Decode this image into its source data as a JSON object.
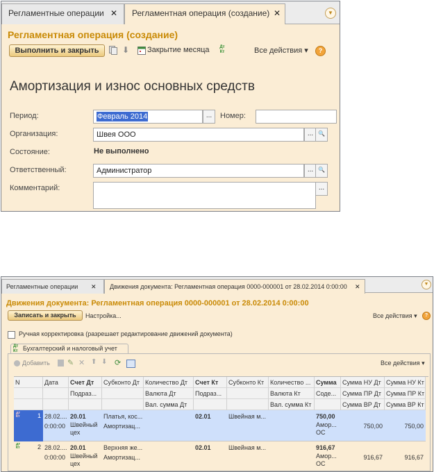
{
  "window1": {
    "tabs": [
      {
        "label": "Регламентные операции"
      },
      {
        "label": "Регламентная операция (создание)"
      }
    ],
    "close_glyph": "✕",
    "form_title": "Регламентная операция (создание)",
    "toolbar": {
      "run_close": "Выполнить и закрыть",
      "month_close": "Закрытие месяца",
      "all_actions": "Все действия ▾",
      "help": "?",
      "dtkt_icon_text": "Дт Кт"
    },
    "operation_title": "Амортизация и износ основных средств",
    "fields": {
      "period_label": "Период:",
      "period_value": "Февраль 2014",
      "number_label": "Номер:",
      "number_value": "",
      "org_label": "Организация:",
      "org_value": "Швея ООО",
      "state_label": "Состояние:",
      "state_value": "Не выполнено",
      "resp_label": "Ответственный:",
      "resp_value": "Администратор",
      "comment_label": "Комментарий:",
      "comment_value": ""
    },
    "select_glyph": "...",
    "open_glyph": "🔍"
  },
  "window2": {
    "tabs": [
      {
        "label": "Регламентные операции"
      },
      {
        "label": "Движения документа: Регламентная операция 0000-000001 от 28.02.2014 0:00:00"
      }
    ],
    "form_title": "Движения документа: Регламентная операция 0000-000001 от 28.02.2014 0:00:00",
    "toolbar": {
      "save_close": "Записать и закрыть",
      "settings": "Настройка...",
      "all_actions": "Все действия ▾",
      "help": "?"
    },
    "manual_edit_label": "Ручная корректировка (разрешает редактирование движений документа)",
    "manual_edit_checked": false,
    "subtab_label": "Бухгалтерский и налоговый учет",
    "grid_toolbar": {
      "add": "Добавить",
      "all_actions": "Все действия ▾"
    },
    "columns": [
      [
        "N",
        "",
        ""
      ],
      [
        "Дата",
        "",
        ""
      ],
      [
        "Счет Дт",
        "Подраз...",
        ""
      ],
      [
        "Субконто Дт",
        "",
        ""
      ],
      [
        "Количество Дт",
        "Валюта Дт",
        "Вал. сумма Дт"
      ],
      [
        "Счет Кт",
        "Подраз...",
        ""
      ],
      [
        "Субконто Кт",
        "",
        ""
      ],
      [
        "Количество ...",
        "Валюта Кт",
        "Вал. сумма Кт"
      ],
      [
        "Сумма",
        "Соде...",
        ""
      ],
      [
        "Сумма НУ Дт",
        "Сумма ПР Дт",
        "Сумма ВР Дт"
      ],
      [
        "Сумма НУ Кт",
        "Сумма ПР Кт",
        "Сумма ВР Кт"
      ]
    ],
    "rows": [
      {
        "n": "1",
        "date": "28.02....",
        "time": "0:00:00",
        "acc_dt": "20.01",
        "dept_dt": "Швейный цех",
        "sub_dt1": "Платья, кос...",
        "sub_dt2": "Амортизац...",
        "acc_kt": "02.01",
        "sub_kt1": "Швейная м...",
        "sum": "750,00",
        "content": "Амор... ОС",
        "sum_nu_dt": "750,00",
        "sum_nu_kt": "750,00",
        "selected": true
      },
      {
        "n": "2",
        "date": "28.02....",
        "time": "0:00:00",
        "acc_dt": "20.01",
        "dept_dt": "Швейный цех",
        "sub_dt1": "Верхняя же...",
        "sub_dt2": "Амортизац...",
        "acc_kt": "02.01",
        "sub_kt1": "Швейная м...",
        "sum": "916,67",
        "content": "Амор... ОС",
        "sum_nu_dt": "916,67",
        "sum_nu_kt": "916,67",
        "selected": false
      }
    ]
  },
  "colors": {
    "accent_orange": "#c98a06",
    "form_bg": "#fbedd5",
    "selection_blue": "#3d6bd1",
    "selected_row": "#cfe0fb"
  }
}
